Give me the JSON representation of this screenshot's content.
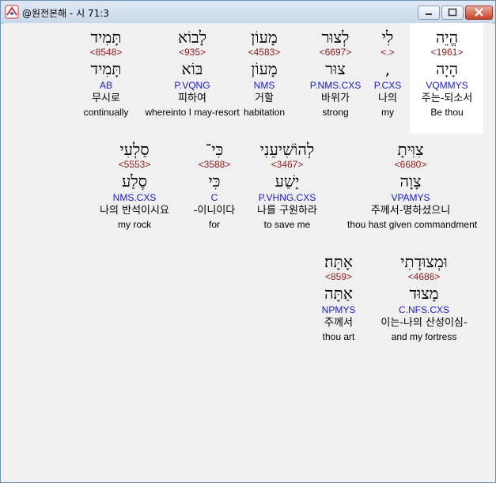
{
  "window": {
    "title": "@원전본해 - 시 71:3"
  },
  "rows": [
    [
      {
        "heb": "תָּמִיד",
        "num": "<8548>",
        "lemma": "תָּמִיד",
        "morph": "AB",
        "kor": "무시로",
        "eng": "continually"
      },
      {
        "heb": "לָבוֹא",
        "num": "<935>",
        "lemma": "בּוֹא",
        "morph": "P.VQNG",
        "kor": "피하여",
        "eng": "whereinto I may-resort"
      },
      {
        "heb": "מָעוֹן",
        "num": "<4583>",
        "lemma": "מָעוֹן",
        "morph": "NMS",
        "kor": "거할",
        "eng": "habitation"
      },
      {
        "heb": "לְצוּר",
        "num": "<6697>",
        "lemma": "צוּר",
        "morph": "P.NMS.CXS",
        "kor": "바위가",
        "eng": "strong"
      },
      {
        "heb": "לִי",
        "num": "<.>",
        "lemma": ",",
        "morph": "P.CXS",
        "kor": "나의",
        "eng": "my"
      },
      {
        "heb": "הֱיֵה",
        "num": "<1961>",
        "lemma": "הָיָה",
        "morph": "VQMMYS",
        "kor": "주는-되소서",
        "eng": "Be thou"
      }
    ],
    [
      {
        "heb": "סַלְעִי",
        "num": "<5553>",
        "lemma": "סֶלַע",
        "morph": "NMS.CXS",
        "kor": "나의 반석이시요",
        "eng": "my rock"
      },
      {
        "heb": "כִּי־",
        "num": "<3588>",
        "lemma": "כִּי",
        "morph": "C",
        "kor": "-이니이다",
        "eng": "for"
      },
      {
        "heb": "לְהוֹשִׁיעֵנִי",
        "num": "<3467>",
        "lemma": "יָשַׁע",
        "morph": "P.VHNG.CXS",
        "kor": "나를 구원하라",
        "eng": "to save me"
      },
      {
        "heb": "צִוִּיתָ",
        "num": "<6680>",
        "lemma": "צָוָה",
        "morph": "VPAMYS",
        "kor": "주께서-명하셨으니",
        "eng": "thou hast given commandment"
      }
    ],
    [
      {
        "heb": "אָתָּה׃",
        "num": "<859>",
        "lemma": "אַתָּה",
        "morph": "NPMYS",
        "kor": "주께서",
        "eng": "thou art"
      },
      {
        "heb": "וּמְצוּדָתִי",
        "num": "<4686>",
        "lemma": "מָצוּד",
        "morph": "C.NFS.CXS",
        "kor": "이는-나의 산성이심-",
        "eng": "and my fortress"
      }
    ]
  ]
}
